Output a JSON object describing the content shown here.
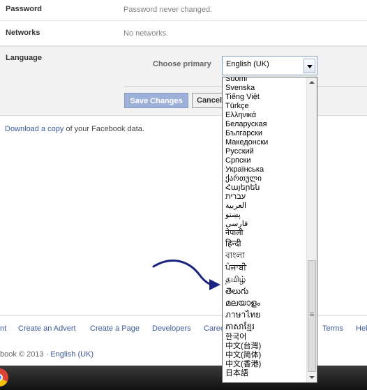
{
  "settings": {
    "password": {
      "label": "Password",
      "value": "Password never changed."
    },
    "networks": {
      "label": "Networks",
      "value": "No networks."
    },
    "language": {
      "label": "Language",
      "choose_label": "Choose primary",
      "selected": "English (UK)",
      "save_label": "Save Changes",
      "cancel_label": "Cancel"
    }
  },
  "download": {
    "link": "Download a copy",
    "rest": " of your Facebook data."
  },
  "dropdown": {
    "options": [
      "Suomi",
      "Svenska",
      "Tiếng Việt",
      "Türkçe",
      "Ελληνικά",
      "Беларуская",
      "Български",
      "Македонски",
      "Русский",
      "Српски",
      "Українська",
      "ქართული",
      "Հայերեն",
      "עברית",
      "العربية",
      "پښتو",
      "فارسی",
      "नेपाली",
      "हिन्दी",
      "বাংলা",
      "ਪੰਜਾਬੀ",
      "தமிழ்",
      "తెలుగు",
      "മലയാളം",
      "ภาษาไทย",
      "ភាសាខ្មែរ",
      "한국어",
      "中文(台灣)",
      "中文(简体)",
      "中文(香港)",
      "日本語"
    ]
  },
  "footer": {
    "links": [
      "nt",
      "Create an Advert",
      "Create a Page",
      "Developers",
      "Caree",
      "Terms",
      "Hel"
    ],
    "copyright": "book © 2013 · ",
    "language_link": "English (UK)"
  },
  "colors": {
    "link": "#3b5998",
    "arrow": "#1a237e",
    "save_button": "#9db0d8"
  },
  "icons": {
    "taskbar": "chrome-icon",
    "select": "chevron-down-icon"
  }
}
